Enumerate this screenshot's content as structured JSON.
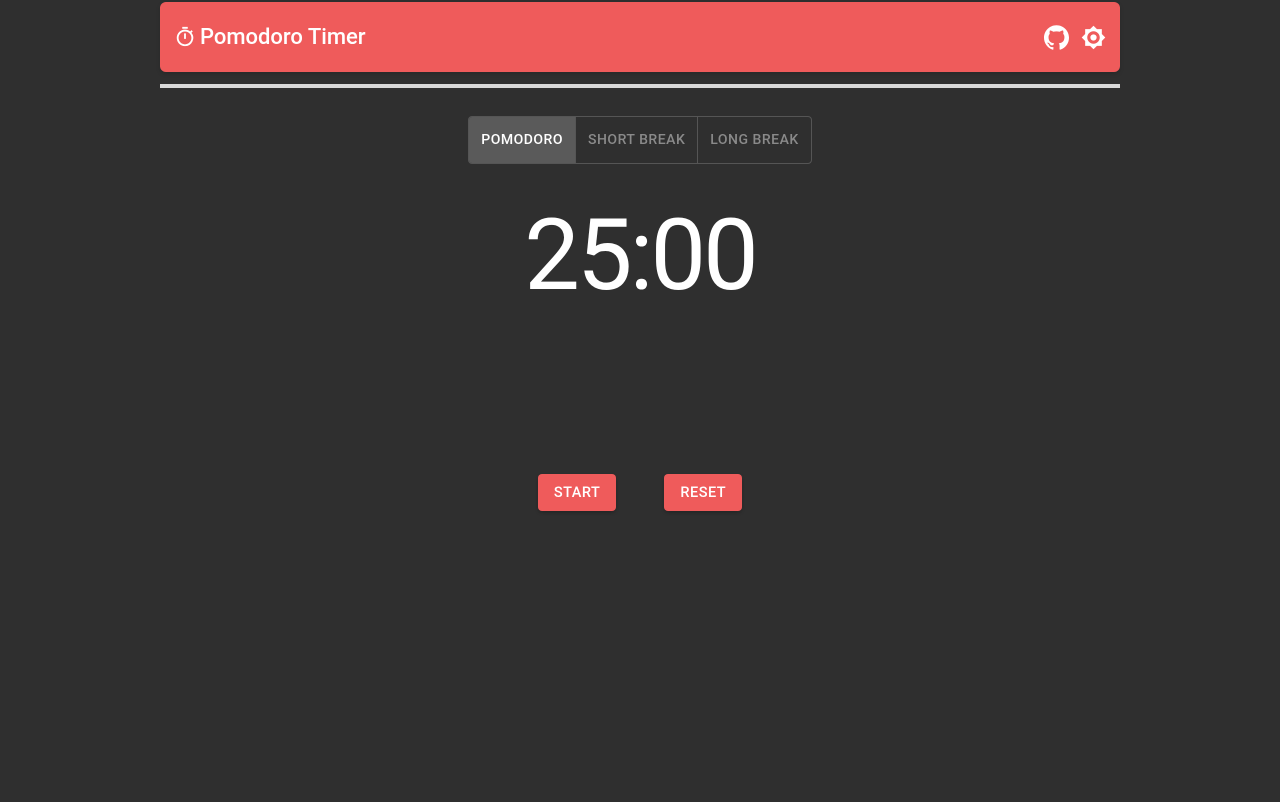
{
  "header": {
    "title": "Pomodoro Timer"
  },
  "tabs": [
    {
      "label": "POMODORO",
      "active": true
    },
    {
      "label": "SHORT BREAK",
      "active": false
    },
    {
      "label": "LONG BREAK",
      "active": false
    }
  ],
  "timer": {
    "display": "25:00"
  },
  "buttons": {
    "start": "START",
    "reset": "RESET"
  },
  "colors": {
    "accent": "#ef5b5b",
    "background": "#2f2f2f",
    "tab_active_bg": "#5a5a5a",
    "tab_inactive_text": "#8a8a8a",
    "divider": "#d9d9d9"
  }
}
